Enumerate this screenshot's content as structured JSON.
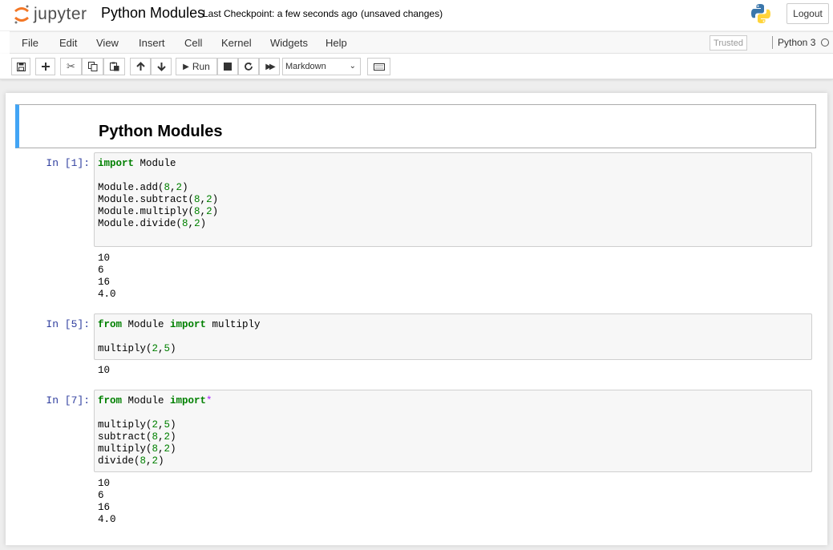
{
  "header": {
    "logo_text": "jupyter",
    "notebook_title": "Python Modules",
    "checkpoint": "Last Checkpoint: a few seconds ago",
    "unsaved": "(unsaved changes)",
    "logout_label": "Logout"
  },
  "menu": {
    "items": [
      "File",
      "Edit",
      "View",
      "Insert",
      "Cell",
      "Kernel",
      "Widgets",
      "Help"
    ],
    "trusted": "Trusted",
    "kernel": "Python 3"
  },
  "toolbar": {
    "run_label": "Run",
    "cell_type": "Markdown"
  },
  "cells": {
    "markdown_title": "Python Modules",
    "cell1": {
      "prompt": "In [1]:",
      "output": "10\n6\n16\n4.0"
    },
    "cell2": {
      "prompt": "In [5]:",
      "output": "10"
    },
    "cell3": {
      "prompt": "In [7]:",
      "output": "10\n6\n16\n4.0"
    }
  }
}
